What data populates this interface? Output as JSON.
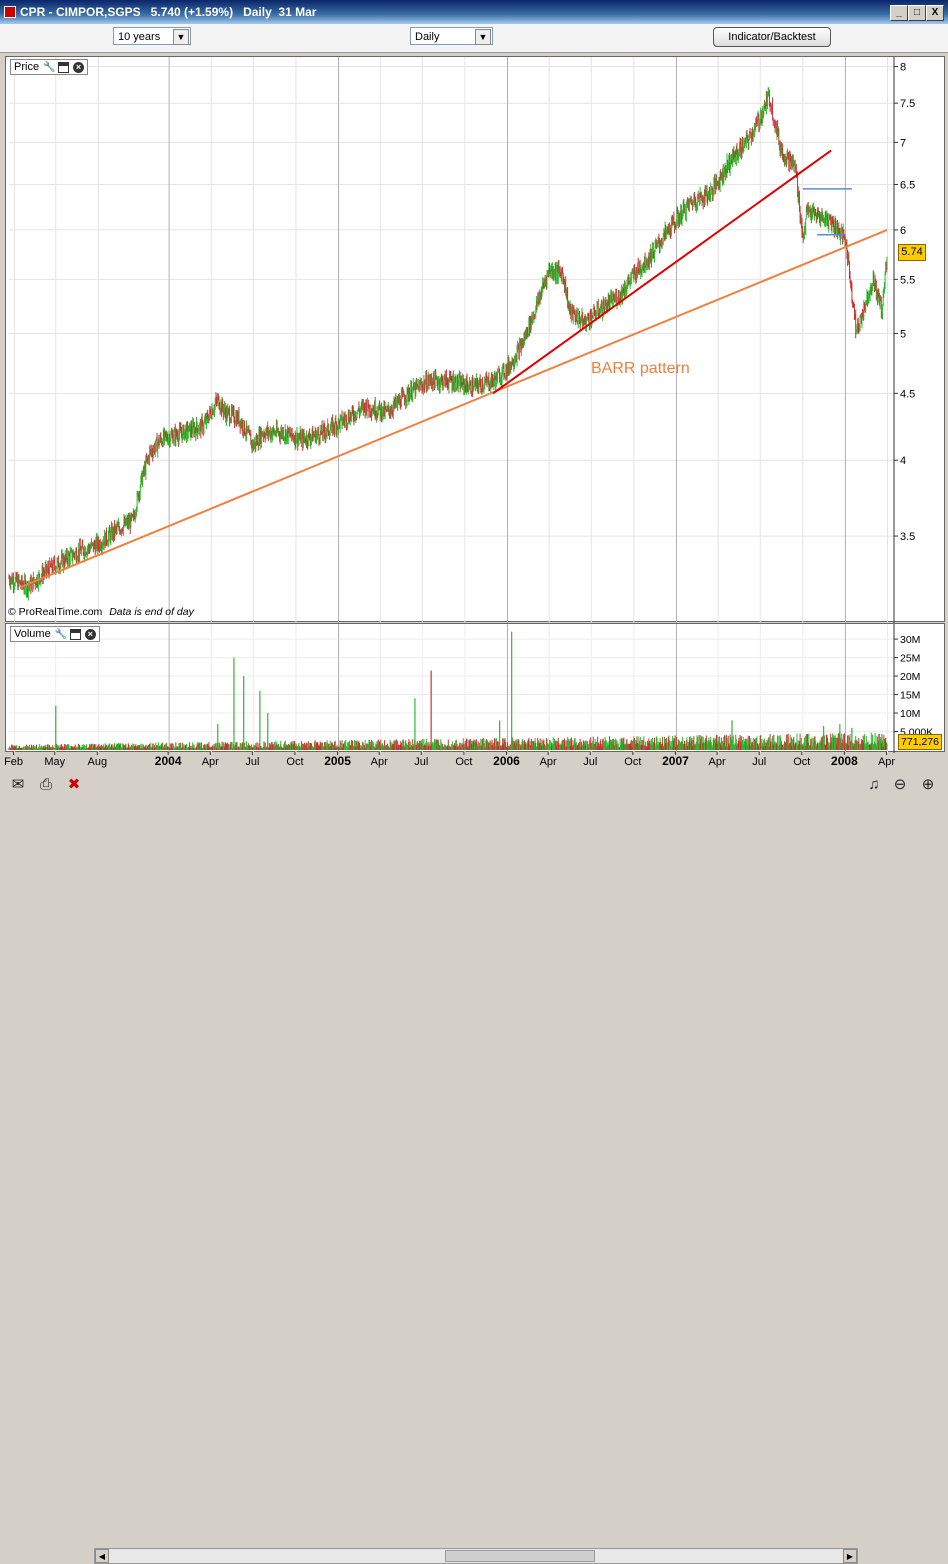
{
  "window": {
    "title": "CPR - CIMPOR,SGPS   5.740 (+1.59%)   Daily  31 Mar",
    "minimize": "_",
    "restore": "□",
    "close": "X"
  },
  "toolbar": {
    "period_select": "10 years",
    "interval_select": "Daily",
    "indicator_button": "Indicator/Backtest"
  },
  "price_panel": {
    "label": "Price",
    "last_price_badge": "5.74",
    "watermark": "© ProRealTime.com",
    "data_note": "Data is end of day",
    "annotation": "BARR pattern"
  },
  "volume_panel": {
    "label": "Volume",
    "last_volume_badge": "771,276"
  },
  "colors": {
    "up": "#2eb82e",
    "down": "#c83232",
    "trend_red": "#e00000",
    "trend_orange": "#f08040",
    "range_blue": "#5a8ae0",
    "badge": "#ffcc00"
  },
  "icons": [
    "wrench-icon",
    "window-icon",
    "close-icon",
    "mail-icon",
    "print-icon",
    "delete-icon",
    "music-icon",
    "zoom-out-icon",
    "zoom-in-icon",
    "arrow-left-icon",
    "arrow-right-icon"
  ],
  "chart_data": [
    {
      "type": "line",
      "name": "Price",
      "y_scale": "log",
      "ylim": [
        3.1,
        8.05
      ],
      "yticks": [
        {
          "value": 8,
          "label": "8"
        },
        {
          "value": 7.5,
          "label": "7.5"
        },
        {
          "value": 7,
          "label": "7"
        },
        {
          "value": 6.5,
          "label": "6.5"
        },
        {
          "value": 6,
          "label": "6"
        },
        {
          "value": 5.5,
          "label": "5.5"
        },
        {
          "value": 5,
          "label": "5"
        },
        {
          "value": 4.5,
          "label": "4.5"
        },
        {
          "value": 4,
          "label": "4"
        },
        {
          "value": 3.5,
          "label": "3.5"
        }
      ],
      "xlim": [
        "2003-01-20",
        "2008-04-15"
      ],
      "xticks": [
        {
          "date": "2003-02-01",
          "label": "Feb",
          "bold": false
        },
        {
          "date": "2003-05-01",
          "label": "May",
          "bold": false
        },
        {
          "date": "2003-08-01",
          "label": "Aug",
          "bold": false
        },
        {
          "date": "2004-01-01",
          "label": "2004",
          "bold": true
        },
        {
          "date": "2004-04-01",
          "label": "Apr",
          "bold": false
        },
        {
          "date": "2004-07-01",
          "label": "Jul",
          "bold": false
        },
        {
          "date": "2004-10-01",
          "label": "Oct",
          "bold": false
        },
        {
          "date": "2005-01-01",
          "label": "2005",
          "bold": true
        },
        {
          "date": "2005-04-01",
          "label": "Apr",
          "bold": false
        },
        {
          "date": "2005-07-01",
          "label": "Jul",
          "bold": false
        },
        {
          "date": "2005-10-01",
          "label": "Oct",
          "bold": false
        },
        {
          "date": "2006-01-01",
          "label": "2006",
          "bold": true
        },
        {
          "date": "2006-04-01",
          "label": "Apr",
          "bold": false
        },
        {
          "date": "2006-07-01",
          "label": "Jul",
          "bold": false
        },
        {
          "date": "2006-10-01",
          "label": "Oct",
          "bold": false
        },
        {
          "date": "2007-01-01",
          "label": "2007",
          "bold": true
        },
        {
          "date": "2007-04-01",
          "label": "Apr",
          "bold": false
        },
        {
          "date": "2007-07-01",
          "label": "Jul",
          "bold": false
        },
        {
          "date": "2007-10-01",
          "label": "Oct",
          "bold": false
        },
        {
          "date": "2008-01-01",
          "label": "2008",
          "bold": true
        },
        {
          "date": "2008-04-01",
          "label": "Apr",
          "bold": false
        }
      ],
      "series": [
        {
          "points": [
            [
              "2003-01-20",
              3.25
            ],
            [
              "2003-03-01",
              3.2
            ],
            [
              "2003-04-15",
              3.3
            ],
            [
              "2003-05-15",
              3.35
            ],
            [
              "2003-06-15",
              3.4
            ],
            [
              "2003-08-01",
              3.45
            ],
            [
              "2003-09-15",
              3.55
            ],
            [
              "2003-10-15",
              3.6
            ],
            [
              "2003-11-01",
              3.85
            ],
            [
              "2003-11-20",
              4.05
            ],
            [
              "2003-12-15",
              4.15
            ],
            [
              "2004-02-01",
              4.2
            ],
            [
              "2004-03-15",
              4.25
            ],
            [
              "2004-04-15",
              4.45
            ],
            [
              "2004-05-01",
              4.35
            ],
            [
              "2004-06-01",
              4.3
            ],
            [
              "2004-07-01",
              4.1
            ],
            [
              "2004-07-20",
              4.2
            ],
            [
              "2004-09-01",
              4.2
            ],
            [
              "2004-10-15",
              4.15
            ],
            [
              "2004-12-01",
              4.2
            ],
            [
              "2005-01-15",
              4.3
            ],
            [
              "2005-03-01",
              4.4
            ],
            [
              "2005-04-15",
              4.35
            ],
            [
              "2005-06-01",
              4.5
            ],
            [
              "2005-07-15",
              4.6
            ],
            [
              "2005-09-01",
              4.6
            ],
            [
              "2005-10-15",
              4.55
            ],
            [
              "2005-12-01",
              4.6
            ],
            [
              "2006-01-01",
              4.7
            ],
            [
              "2006-02-01",
              4.9
            ],
            [
              "2006-03-01",
              5.2
            ],
            [
              "2006-04-01",
              5.6
            ],
            [
              "2006-05-01",
              5.55
            ],
            [
              "2006-05-15",
              5.2
            ],
            [
              "2006-06-15",
              5.1
            ],
            [
              "2006-07-15",
              5.2
            ],
            [
              "2006-09-01",
              5.35
            ],
            [
              "2006-10-01",
              5.55
            ],
            [
              "2006-11-01",
              5.7
            ],
            [
              "2006-12-15",
              6.0
            ],
            [
              "2007-02-01",
              6.3
            ],
            [
              "2007-03-15",
              6.4
            ],
            [
              "2007-05-01",
              6.8
            ],
            [
              "2007-06-01",
              7.0
            ],
            [
              "2007-07-01",
              7.3
            ],
            [
              "2007-07-20",
              7.6
            ],
            [
              "2007-08-15",
              6.9
            ],
            [
              "2007-09-15",
              6.7
            ],
            [
              "2007-10-01",
              5.9
            ],
            [
              "2007-10-10",
              6.2
            ],
            [
              "2007-11-01",
              6.15
            ],
            [
              "2007-12-01",
              6.1
            ],
            [
              "2008-01-01",
              5.9
            ],
            [
              "2008-01-25",
              5.0
            ],
            [
              "2008-02-15",
              5.3
            ],
            [
              "2008-03-01",
              5.5
            ],
            [
              "2008-03-20",
              5.2
            ],
            [
              "2008-03-31",
              5.74
            ]
          ]
        }
      ],
      "trendlines": [
        {
          "color": "orange",
          "from": [
            "2003-02-15",
            3.2
          ],
          "to": [
            "2008-03-31",
            6.0
          ]
        },
        {
          "color": "red",
          "from": [
            "2005-12-01",
            4.5
          ],
          "to": [
            "2007-12-01",
            6.9
          ]
        },
        {
          "color": "blue",
          "from": [
            "2007-10-01",
            6.45
          ],
          "to": [
            "2008-01-15",
            6.45
          ]
        },
        {
          "color": "blue",
          "from": [
            "2007-11-01",
            5.95
          ],
          "to": [
            "2008-01-01",
            5.95
          ]
        }
      ]
    },
    {
      "type": "bar",
      "name": "Volume",
      "ylim": [
        0,
        33000000
      ],
      "yticks": [
        {
          "value": 30000000,
          "label": "30M"
        },
        {
          "value": 25000000,
          "label": "25M"
        },
        {
          "value": 20000000,
          "label": "20M"
        },
        {
          "value": 15000000,
          "label": "15M"
        },
        {
          "value": 10000000,
          "label": "10M"
        },
        {
          "value": 5000000,
          "label": "5,000K"
        }
      ],
      "spikes": [
        [
          "2003-05-01",
          12000000
        ],
        [
          "2004-04-15",
          7000000
        ],
        [
          "2004-05-20",
          25000000
        ],
        [
          "2004-06-10",
          20000000
        ],
        [
          "2004-07-15",
          16000000
        ],
        [
          "2004-08-01",
          10000000
        ],
        [
          "2005-06-15",
          14000000
        ],
        [
          "2005-07-20",
          21500000
        ],
        [
          "2005-12-15",
          8000000
        ],
        [
          "2006-01-10",
          32000000
        ],
        [
          "2007-05-01",
          8000000
        ],
        [
          "2007-11-15",
          6500000
        ],
        [
          "2007-12-20",
          7000000
        ],
        [
          "2008-01-15",
          6000000
        ]
      ],
      "baseline": 1000000
    }
  ]
}
